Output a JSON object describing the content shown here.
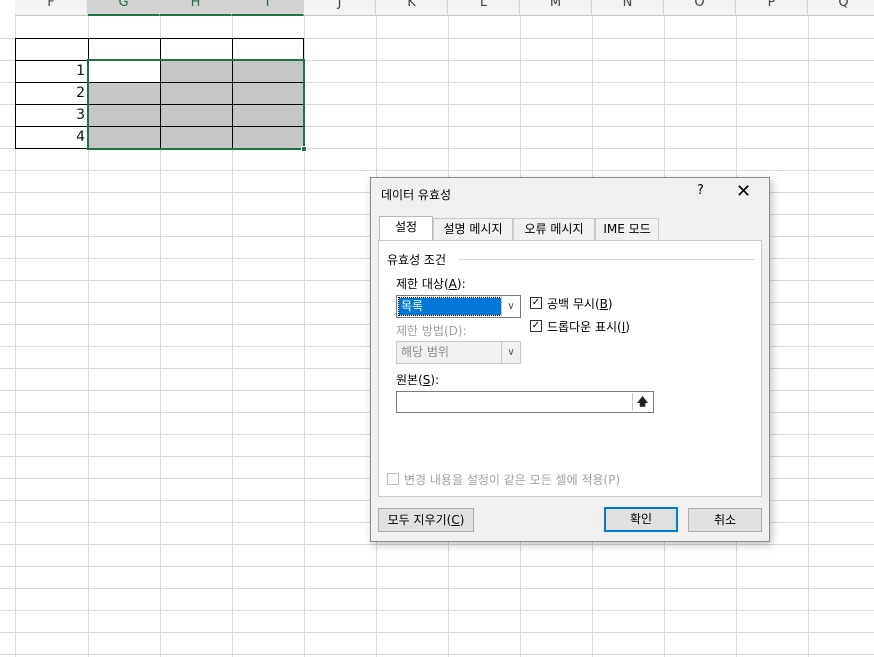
{
  "columns": [
    "F",
    "G",
    "H",
    "I",
    "J",
    "K",
    "L",
    "M",
    "N",
    "O",
    "P",
    "Q"
  ],
  "selected_columns": [
    "G",
    "H",
    "I"
  ],
  "cells": {
    "row1": "1",
    "row2": "2",
    "row3": "3",
    "row4": "4"
  },
  "dialog": {
    "title": "데이터 유효성",
    "help": "?",
    "close": "✕",
    "tabs": [
      "설정",
      "설명 메시지",
      "오류 메시지",
      "IME 모드"
    ],
    "group_title": "유효성 조건",
    "allow_label": "제한 대상(",
    "allow_key": "A",
    "allow_label_end": "):",
    "allow_value": "목록",
    "method_label": "제한 방법(D):",
    "method_value": "해당 범위",
    "ignore_blank_label": "공백 무시(",
    "ignore_blank_key": "B",
    "ignore_blank_end": ")",
    "dropdown_label": "드롭다운 표시(",
    "dropdown_key": "I",
    "dropdown_end": ")",
    "source_label": "원본(",
    "source_key": "S",
    "source_end": "):",
    "source_value": "",
    "apply_all_label": "변경 내용을 설정이 같은 모든 셀에 적용(P)",
    "clear_all_label": "모두 지우기(",
    "clear_all_key": "C",
    "clear_all_end": ")",
    "ok_label": "확인",
    "cancel_label": "취소",
    "ignore_blank_checked": true,
    "dropdown_checked": true,
    "apply_all_checked": false
  },
  "colors": {
    "selection_fill": "#c6c6c6",
    "selection_border": "#217346",
    "accent": "#0078d7"
  }
}
